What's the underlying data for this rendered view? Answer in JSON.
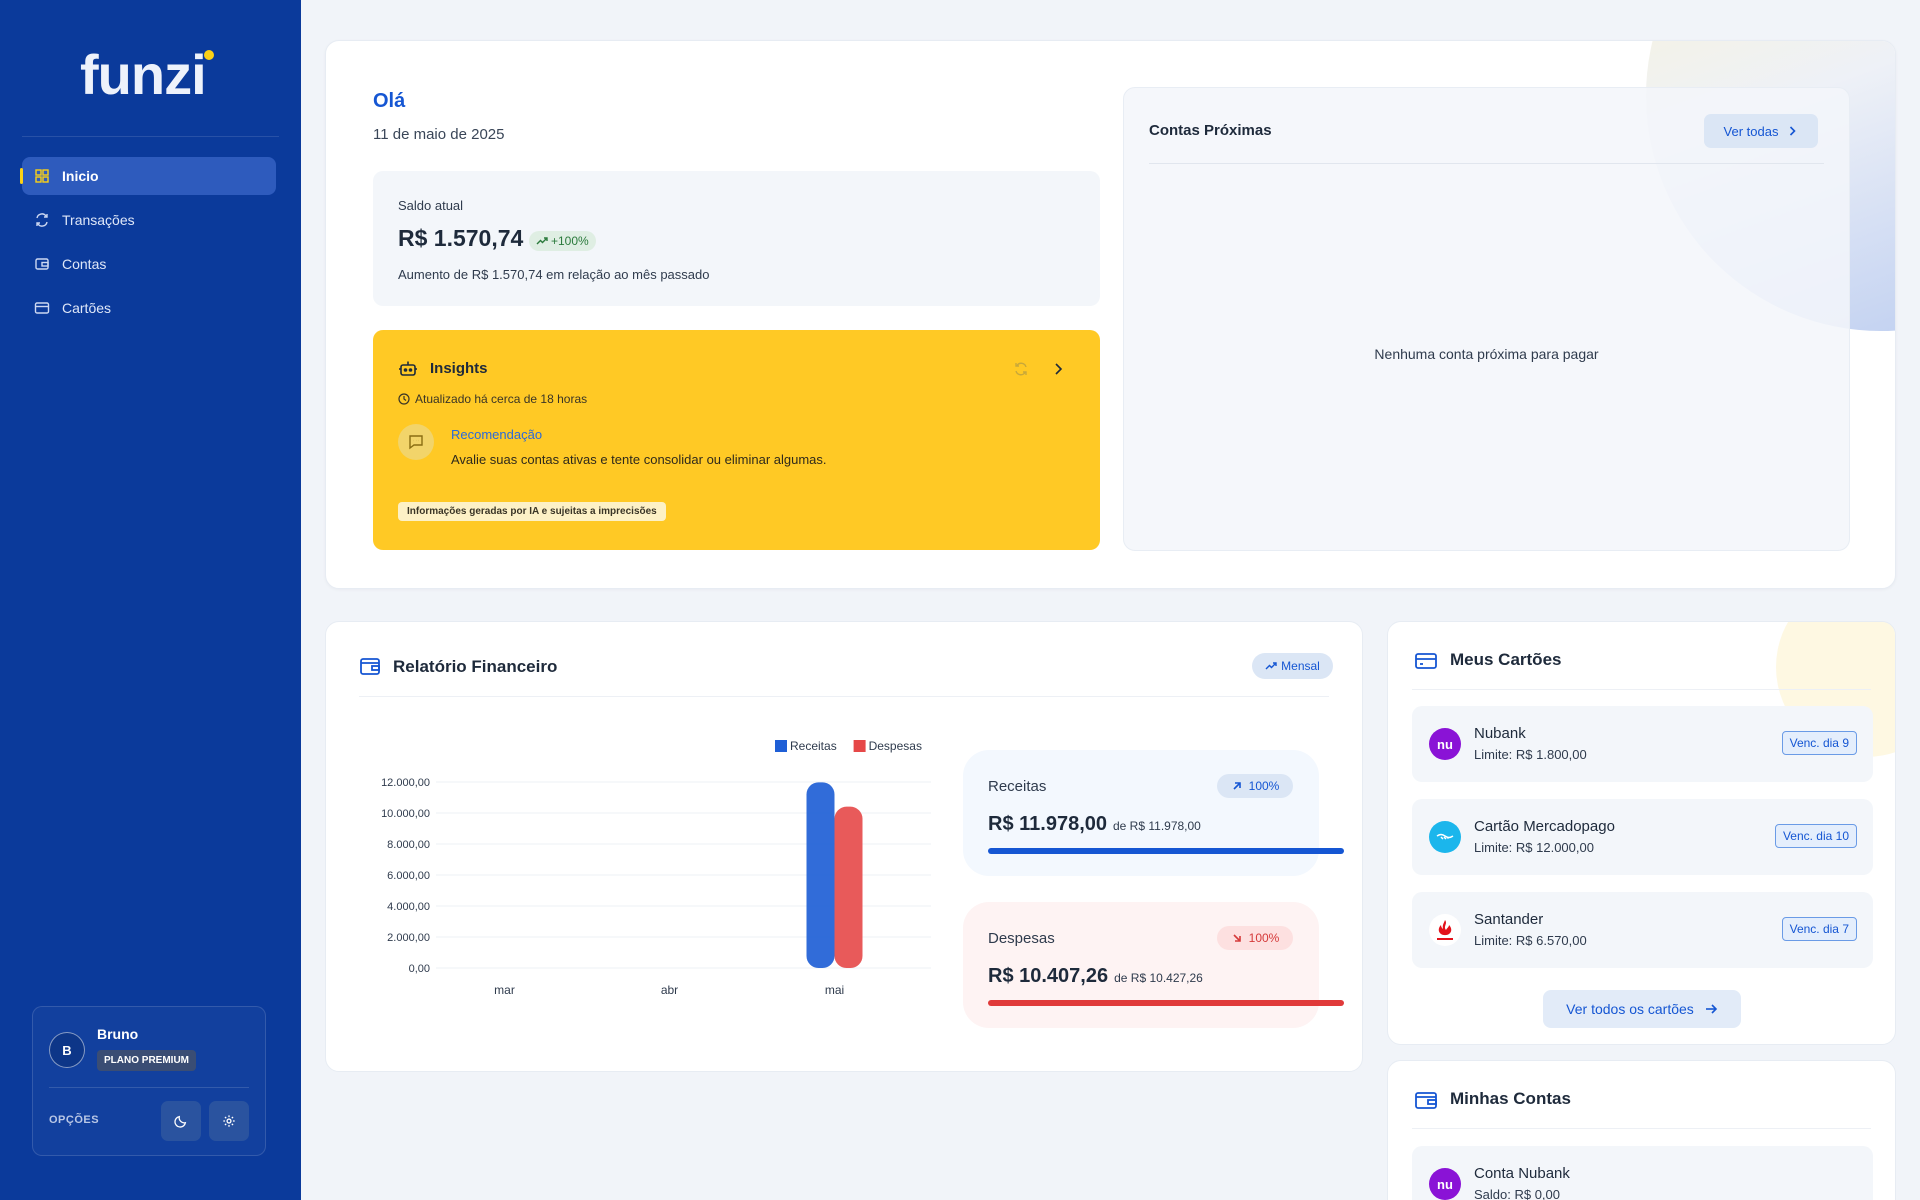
{
  "app": {
    "logo": "funzi"
  },
  "sidebar": {
    "items": [
      {
        "label": "Inicio",
        "icon": "grid-icon",
        "active": true
      },
      {
        "label": "Transações",
        "icon": "exchange-icon",
        "active": false
      },
      {
        "label": "Contas",
        "icon": "wallet-icon",
        "active": false
      },
      {
        "label": "Cartões",
        "icon": "credit-card-icon",
        "active": false
      }
    ],
    "user": {
      "initial": "B",
      "name": "Bruno",
      "plan": "PLANO PREMIUM"
    },
    "options_label": "OPÇÕES"
  },
  "header": {
    "greeting": "Olá",
    "date": "11 de maio de 2025"
  },
  "balance": {
    "label": "Saldo atual",
    "value": "R$ 1.570,74",
    "change": "+100%",
    "description": "Aumento de R$ 1.570,74 em relação ao mês passado"
  },
  "insights": {
    "title": "Insights",
    "updated": "Atualizado há cerca de 18 horas",
    "recommendation_title": "Recomendação",
    "recommendation_text": "Avalie suas contas ativas e tente consolidar ou eliminar algumas.",
    "disclaimer": "Informações geradas por IA e sujeitas a imprecisões"
  },
  "upcoming": {
    "title": "Contas Próximas",
    "view_all": "Ver todas",
    "empty": "Nenhuma conta próxima para pagar"
  },
  "report": {
    "title": "Relatório Financeiro",
    "period": "Mensal",
    "income": {
      "label": "Receitas",
      "percent": "100%",
      "value": "R$ 11.978,00",
      "of": "de R$ 11.978,00",
      "fill": 1.0
    },
    "expenses": {
      "label": "Despesas",
      "percent": "100%",
      "value": "R$ 10.407,26",
      "of": "de R$ 10.427,26",
      "fill": 1.0
    }
  },
  "chart_data": {
    "type": "bar",
    "categories": [
      "mar",
      "abr",
      "mai"
    ],
    "series": [
      {
        "name": "Receitas",
        "values": [
          0,
          0,
          11978.0
        ],
        "color": "#1f5fd6"
      },
      {
        "name": "Despesas",
        "values": [
          0,
          0,
          10407.26
        ],
        "color": "#e64848"
      }
    ],
    "ylim": [
      0,
      12000
    ],
    "yticks": [
      0,
      2000,
      4000,
      6000,
      8000,
      10000,
      12000
    ],
    "ytick_labels": [
      "0,00",
      "2.000,00",
      "4.000,00",
      "6.000,00",
      "8.000,00",
      "10.000,00",
      "12.000,00"
    ],
    "legend": "top-right",
    "grid": true
  },
  "cards": {
    "title": "Meus Cartões",
    "items": [
      {
        "name": "Nubank",
        "limit": "Limite: R$ 1.800,00",
        "due": "Venc. dia 9",
        "logo_text": "nu",
        "logo_color": "#8a13d6"
      },
      {
        "name": "Cartão Mercadopago",
        "limit": "Limite: R$ 12.000,00",
        "due": "Venc. dia 10",
        "logo_text": "",
        "logo_color": "#1bb6ec"
      },
      {
        "name": "Santander",
        "limit": "Limite: R$ 6.570,00",
        "due": "Venc. dia 7",
        "logo_text": "",
        "logo_color": "#ffffff"
      }
    ],
    "view_all": "Ver todos os cartões"
  },
  "accounts": {
    "title": "Minhas Contas",
    "items": [
      {
        "name": "Conta Nubank",
        "balance": "Saldo: R$ 0,00",
        "logo_text": "nu",
        "logo_color": "#8a13d6"
      }
    ]
  }
}
